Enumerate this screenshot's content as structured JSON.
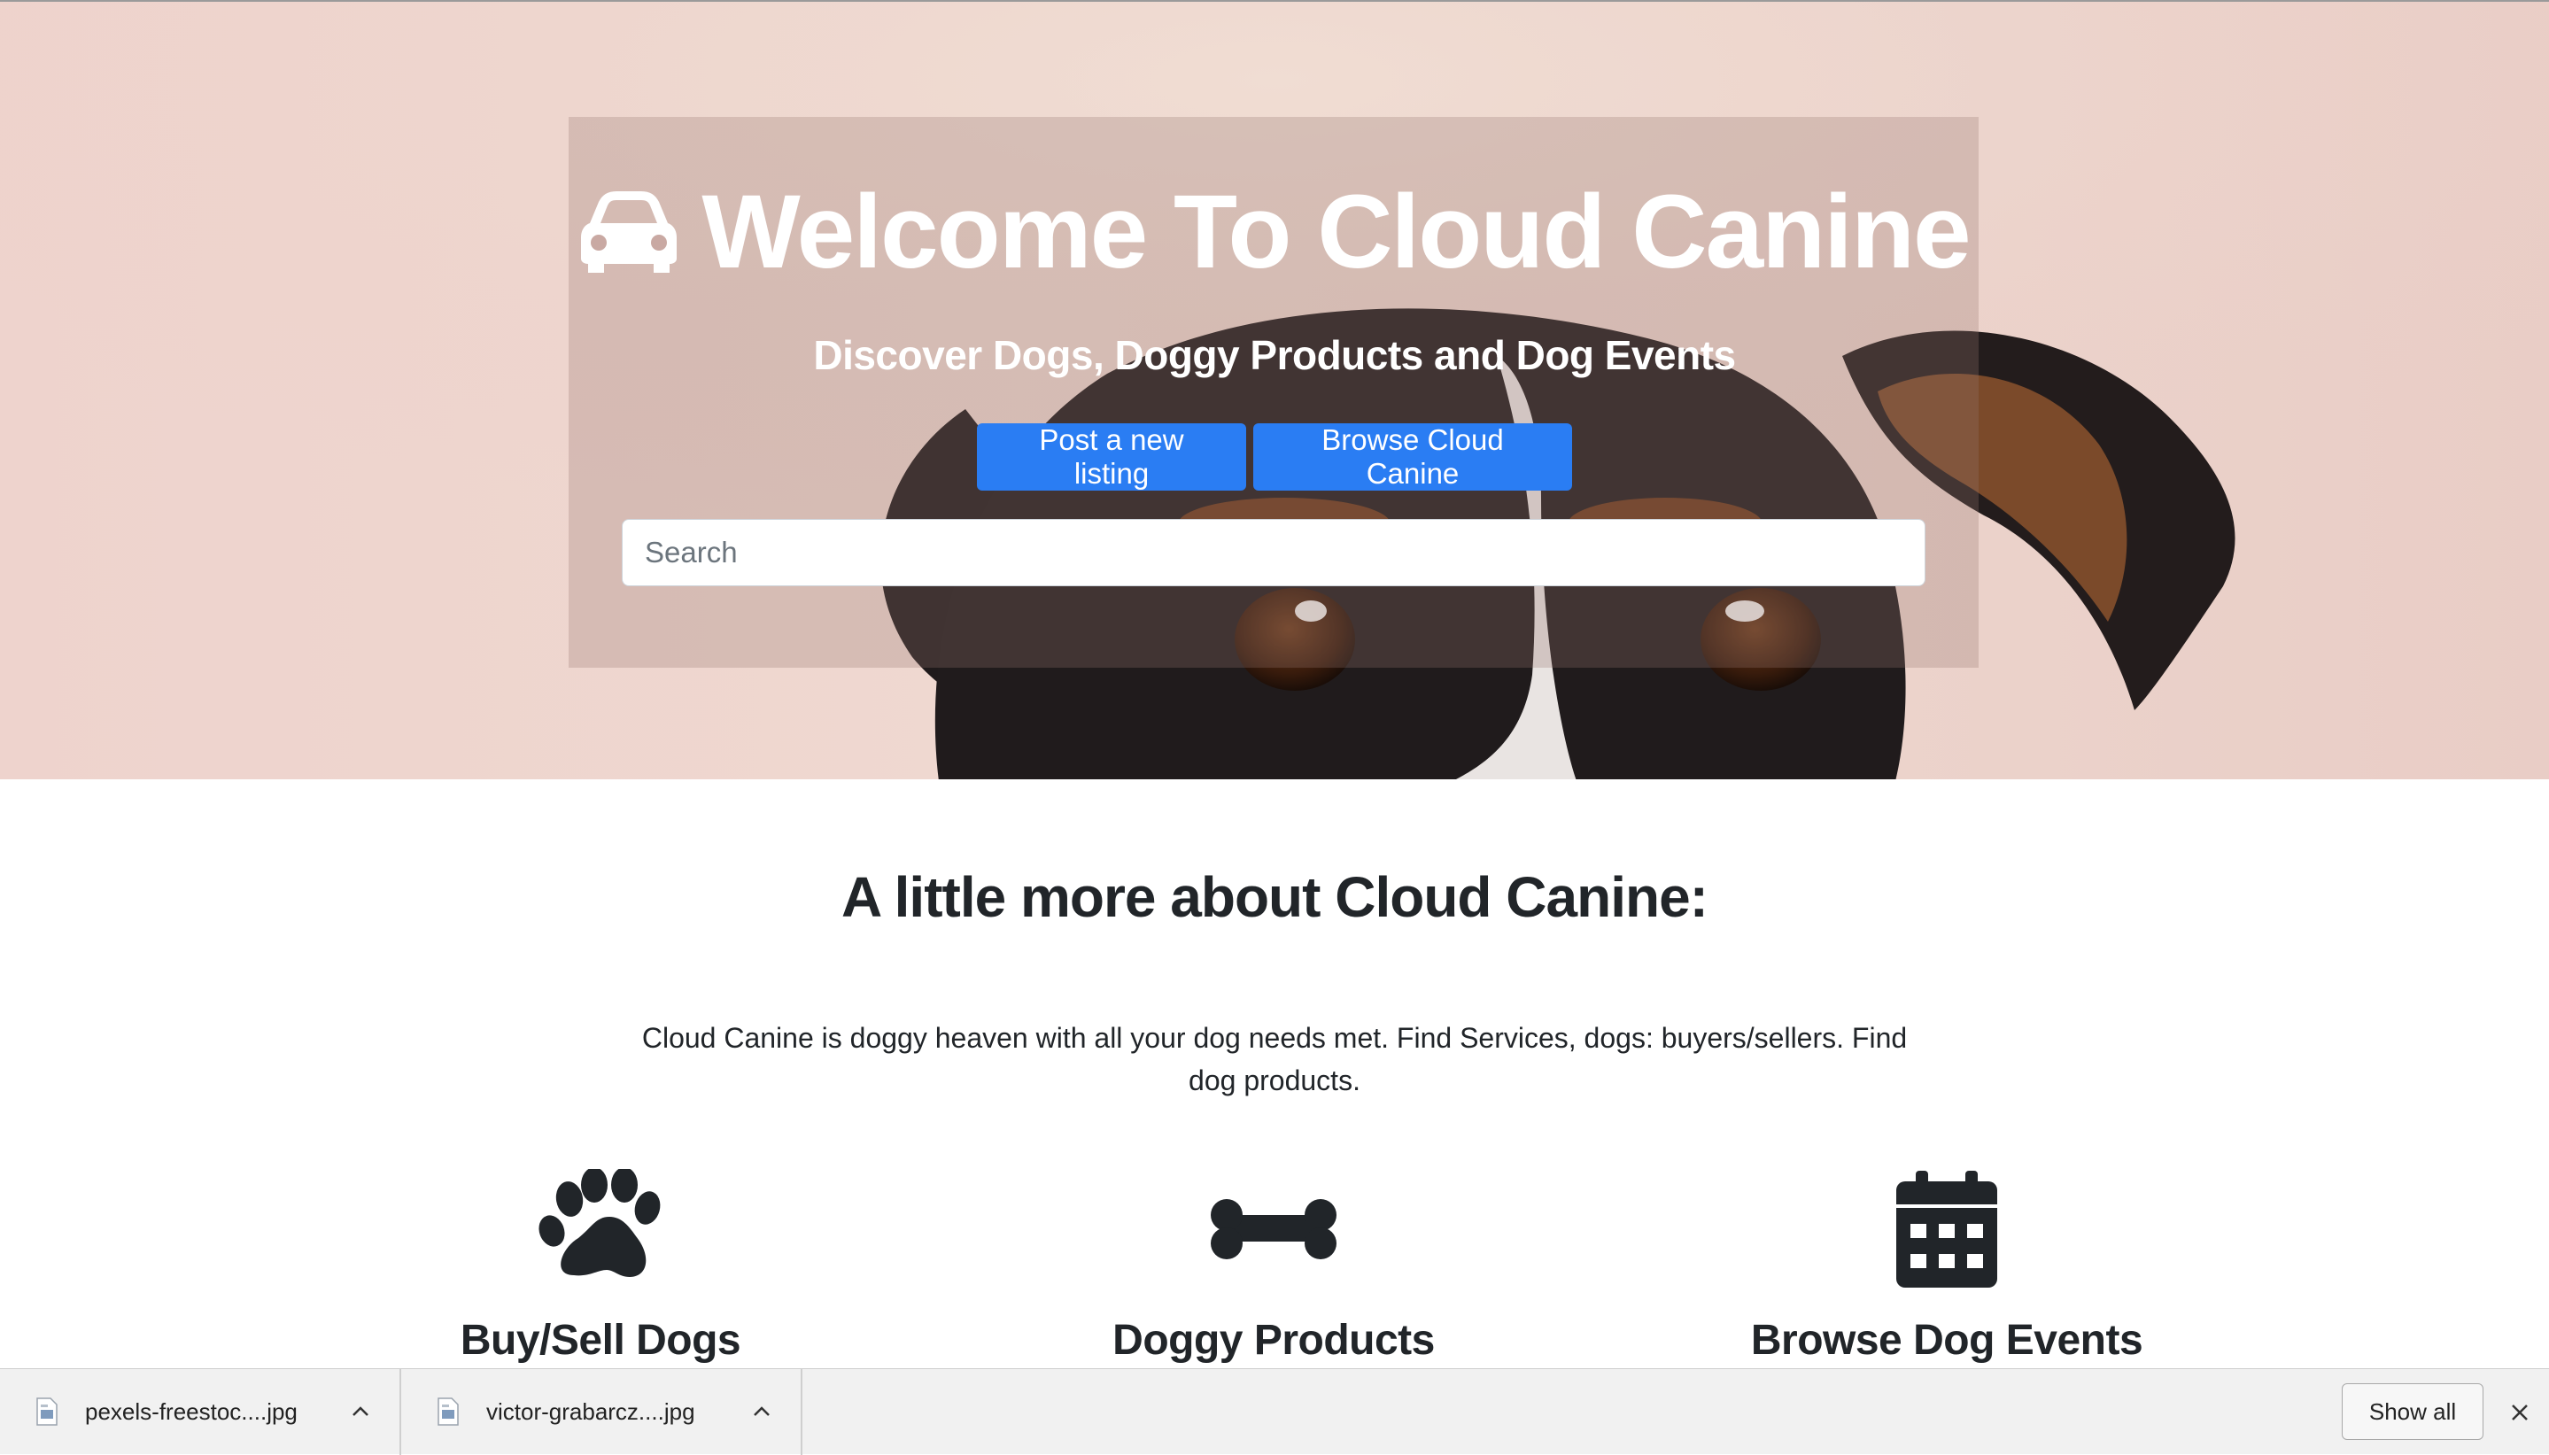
{
  "hero": {
    "title": "Welcome To Cloud Canine",
    "title_icon": "car-icon",
    "subtitle": "Discover Dogs, Doggy Products and Dog Events",
    "buttons": {
      "post": "Post a new listing",
      "browse": "Browse Cloud Canine"
    },
    "search": {
      "placeholder": "Search",
      "value": ""
    },
    "background_image": "dog-peeking-photo"
  },
  "about": {
    "heading": "A little more about Cloud Canine:",
    "text": "Cloud Canine is doggy heaven with all your dog needs met. Find Services, dogs: buyers/sellers. Find dog products."
  },
  "features": [
    {
      "icon": "paw-icon",
      "title": "Buy/Sell Dogs"
    },
    {
      "icon": "bone-icon",
      "title": "Doggy Products"
    },
    {
      "icon": "calendar-icon",
      "title": "Browse Dog Events"
    }
  ],
  "downloads": {
    "items": [
      {
        "name": "pexels-freestoc....jpg"
      },
      {
        "name": "victor-grabarcz....jpg"
      }
    ],
    "show_all": "Show all"
  },
  "colors": {
    "primary": "#2a7df3",
    "text": "#212529",
    "hero_bg": "#eed3cd"
  }
}
